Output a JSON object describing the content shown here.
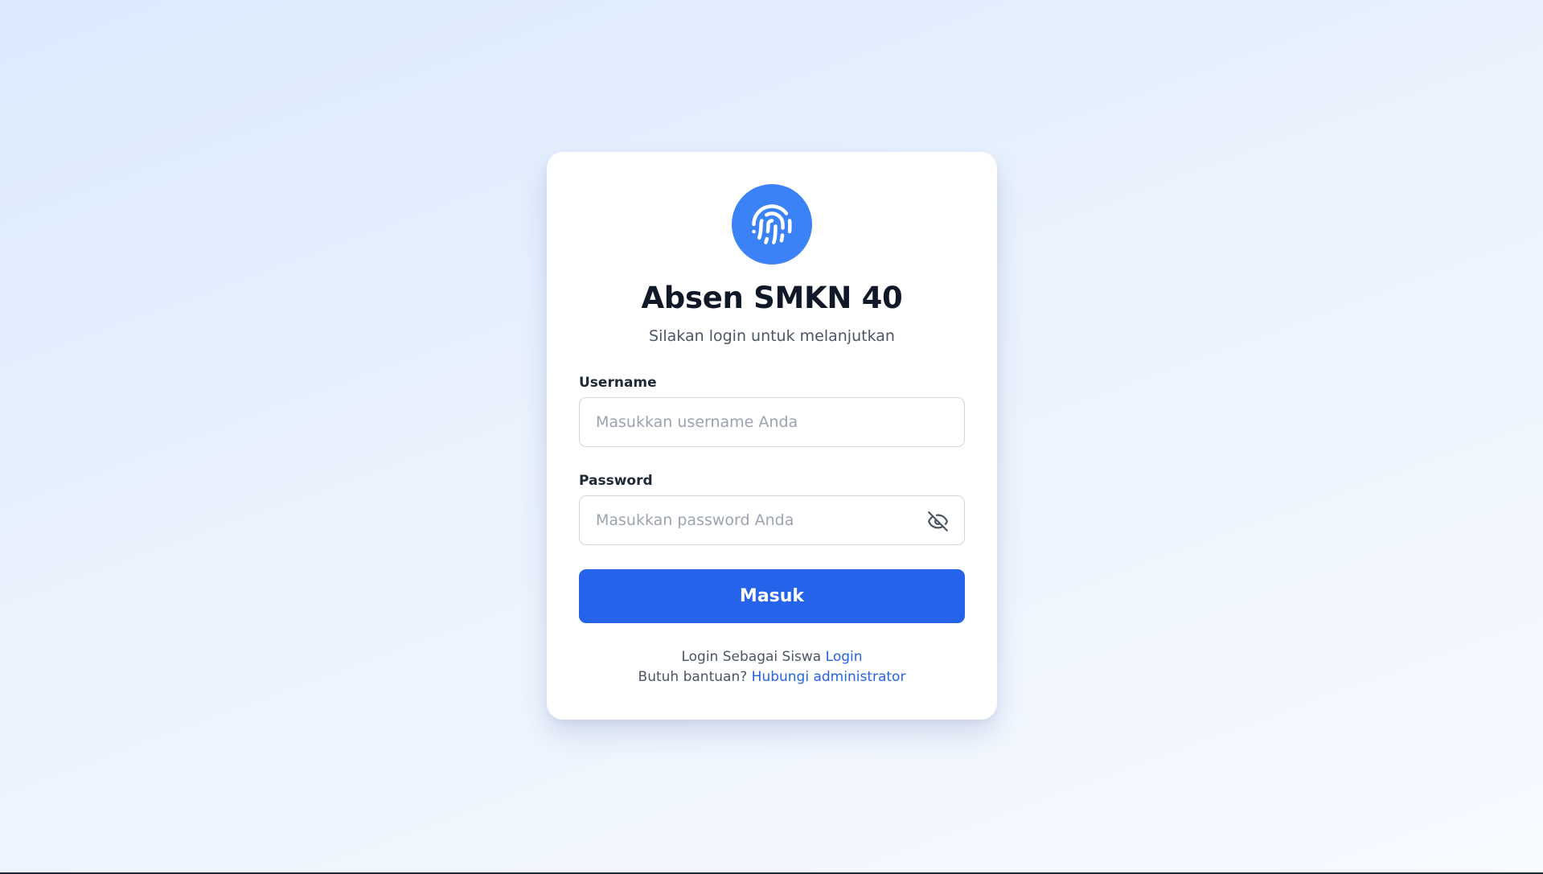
{
  "app": {
    "title": "Absen SMKN 40",
    "subtitle": "Silakan login untuk melanjutkan",
    "logo_icon": "fingerprint-icon"
  },
  "form": {
    "username": {
      "label": "Username",
      "placeholder": "Masukkan username Anda",
      "value": ""
    },
    "password": {
      "label": "Password",
      "placeholder": "Masukkan password Anda",
      "value": "",
      "toggle_icon": "eye-off-icon"
    },
    "submit_label": "Masuk"
  },
  "footer": {
    "student_text": "Login Sebagai Siswa",
    "student_link": "Login",
    "help_text": "Butuh bantuan?",
    "help_link": "Hubungi administrator"
  },
  "colors": {
    "primary": "#2563eb",
    "logo_bg": "#3b82f6",
    "title": "#111827",
    "muted_text": "#4b5563",
    "border": "#d1d5db"
  }
}
